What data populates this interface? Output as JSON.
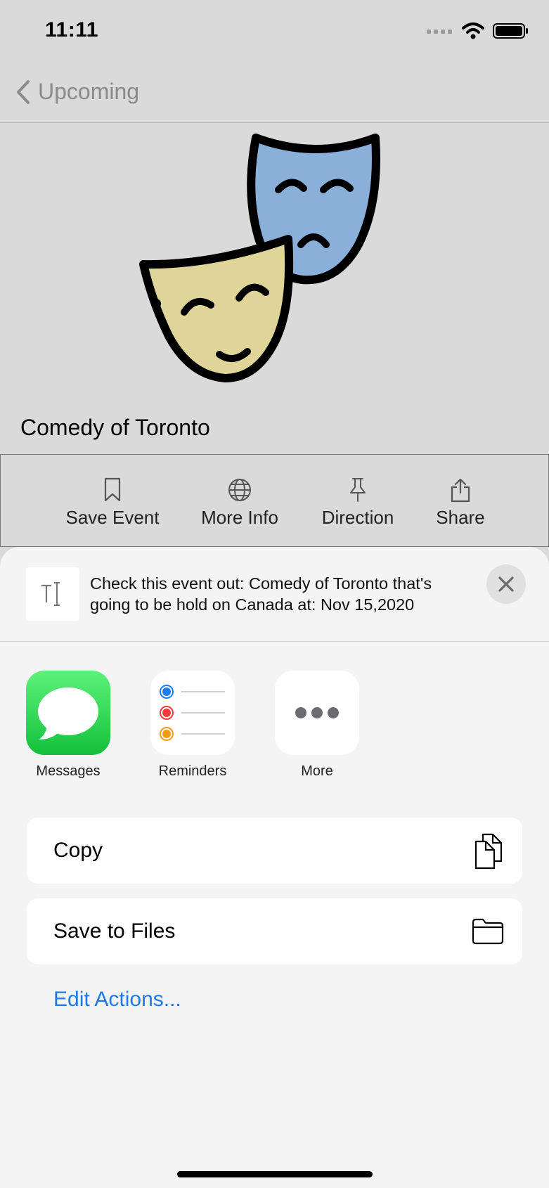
{
  "status": {
    "time": "11:11"
  },
  "nav": {
    "back_label": "Upcoming"
  },
  "event": {
    "title": "Comedy of Toronto"
  },
  "actions": [
    {
      "label": "Save Event",
      "icon": "bookmark-icon"
    },
    {
      "label": "More Info",
      "icon": "globe-icon"
    },
    {
      "label": "Direction",
      "icon": "pin-icon"
    },
    {
      "label": "Share",
      "icon": "share-icon"
    }
  ],
  "share_sheet": {
    "preview_text": "Check this event out: Comedy of Toronto that's going to be hold on Canada at: Nov 15,2020",
    "apps": [
      {
        "label": "Messages",
        "icon": "messages-icon",
        "color": "#2fd158"
      },
      {
        "label": "Reminders",
        "icon": "reminders-icon",
        "color": "#ffffff"
      },
      {
        "label": "More",
        "icon": "more-icon",
        "color": "#ffffff"
      }
    ],
    "rows": [
      {
        "label": "Copy",
        "icon": "copy-icon"
      },
      {
        "label": "Save to Files",
        "icon": "folder-icon"
      }
    ],
    "edit_actions": "Edit Actions..."
  },
  "colors": {
    "mask_blue": "#8aafd8",
    "mask_yellow": "#e0d598",
    "accent": "#1f7ae8"
  }
}
